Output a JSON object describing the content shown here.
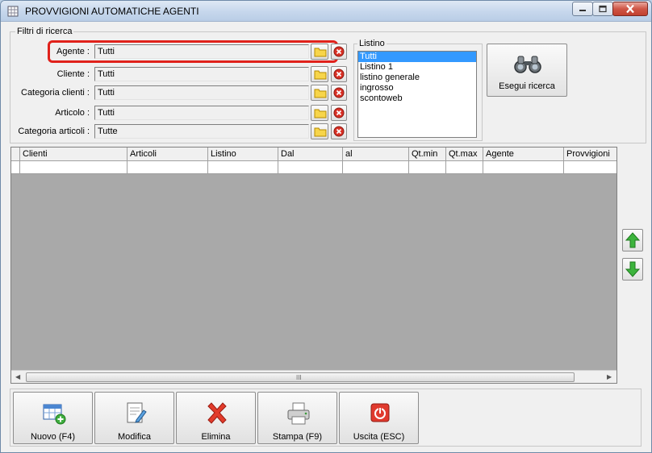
{
  "window": {
    "title": "PROVVIGIONI AUTOMATICHE AGENTI",
    "app_icon": "table-grid-icon",
    "controls": {
      "minimize_icon": "minimize-icon",
      "maximize_icon": "maximize-icon",
      "close_icon": "close-icon"
    }
  },
  "filters": {
    "legend": "Filtri di ricerca",
    "agente": {
      "label": "Agente :",
      "value": "Tutti"
    },
    "cliente": {
      "label": "Cliente :",
      "value": "Tutti"
    },
    "categoria_clienti": {
      "label": "Categoria clienti :",
      "value": "Tutti"
    },
    "articolo": {
      "label": "Articolo :",
      "value": "Tutti"
    },
    "categoria_articoli": {
      "label": "Categoria articoli :",
      "value": "Tutte"
    },
    "listino": {
      "legend": "Listino",
      "items": [
        "Tutti",
        "Listino 1",
        "listino generale",
        "ingrosso",
        "scontoweb"
      ],
      "selected": "Tutti"
    },
    "search_button": {
      "label": "Esegui ricerca",
      "icon": "binoculars-icon"
    },
    "highlight_color": "#e0211b"
  },
  "grid": {
    "columns": [
      "Clienti",
      "Articoli",
      "Listino",
      "Dal",
      "al",
      "Qt.min",
      "Qt.max",
      "Agente",
      "Provvigioni"
    ],
    "scroll_grip": "III"
  },
  "side_buttons": {
    "up_icon": "green-up-arrow-icon",
    "down_icon": "green-down-arrow-icon"
  },
  "toolbar": {
    "nuovo": {
      "label": "Nuovo (F4)",
      "icon": "add-table-icon"
    },
    "modifica": {
      "label": "Modifica",
      "icon": "edit-document-icon"
    },
    "elimina": {
      "label": "Elimina",
      "icon": "red-x-icon"
    },
    "stampa": {
      "label": "Stampa (F9)",
      "icon": "printer-icon"
    },
    "uscita": {
      "label": "Uscita (ESC)",
      "icon": "power-exit-icon"
    }
  },
  "colors": {
    "selection": "#3399ff",
    "grid_background": "#a9a9a9",
    "window_bg": "#f0f0f0"
  }
}
